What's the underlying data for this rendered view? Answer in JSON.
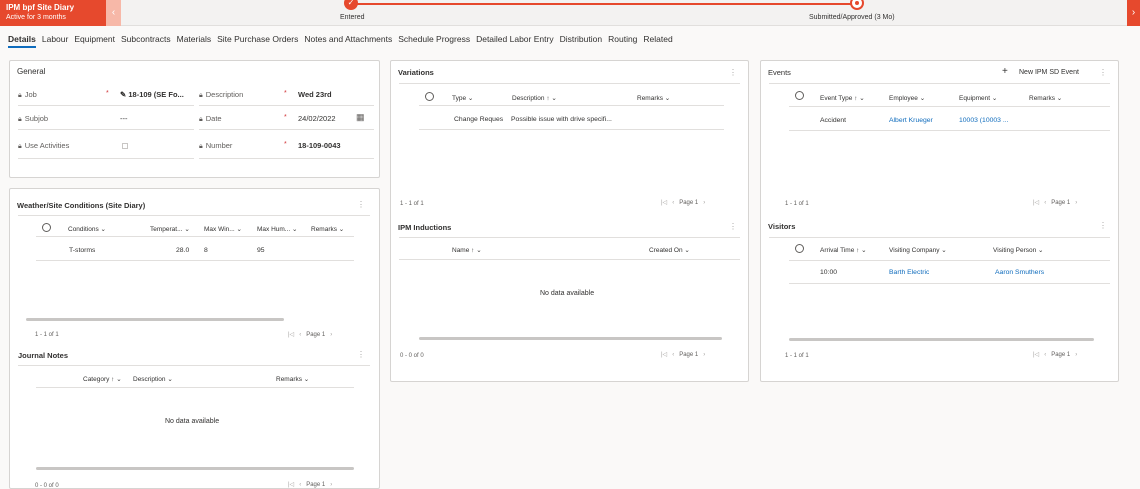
{
  "bpf": {
    "title": "IPM bpf Site Diary",
    "subtitle": "Active for 3 months",
    "prev_icon": "chevron-left-icon",
    "next_icon": "chevron-right-icon",
    "stages": [
      {
        "label": "Entered",
        "status": "completed",
        "check": "✓"
      },
      {
        "label": "Submitted/Approved  (3 Mo)",
        "status": "active"
      }
    ],
    "accent": "#e6492d"
  },
  "tabs": [
    {
      "label": "Details",
      "active": true
    },
    {
      "label": "Labour"
    },
    {
      "label": "Equipment"
    },
    {
      "label": "Subcontracts"
    },
    {
      "label": "Materials"
    },
    {
      "label": "Site Purchase Orders"
    },
    {
      "label": "Notes and Attachments"
    },
    {
      "label": "Schedule Progress"
    },
    {
      "label": "Detailed Labor Entry"
    },
    {
      "label": "Distribution"
    },
    {
      "label": "Routing"
    },
    {
      "label": "Related"
    }
  ],
  "general": {
    "title": "General",
    "fields": {
      "job": {
        "label": "Job",
        "value": "18-109 (SE Fo...",
        "required": "*"
      },
      "subjob": {
        "label": "Subjob",
        "value": "---"
      },
      "use_activities": {
        "label": "Use Activities"
      },
      "description": {
        "label": "Description",
        "value": "Wed 23rd",
        "required": "*"
      },
      "date": {
        "label": "Date",
        "value": "24/02/2022",
        "required": "*"
      },
      "number": {
        "label": "Number",
        "value": "18-109-0043",
        "required": "*"
      }
    }
  },
  "weather": {
    "title": "Weather/Site Conditions (Site Diary)",
    "columns": [
      "Conditions ⌄",
      "Temperat... ⌄",
      "Max Win... ⌄",
      "Max Hum... ⌄",
      "Remarks ⌄"
    ],
    "rows": [
      {
        "conditions": "T-storms",
        "temperature": "28.0",
        "max_wind": "8",
        "max_humidity": "95",
        "remarks": ""
      }
    ],
    "footer_count": "1 - 1 of 1",
    "page": "Page 1"
  },
  "journal": {
    "title": "Journal Notes",
    "columns": [
      "Category ↑ ⌄",
      "Description ⌄",
      "Remarks ⌄"
    ],
    "empty": "No data available",
    "footer_count": "0 - 0 of 0",
    "page": "Page 1"
  },
  "variations": {
    "title": "Variations",
    "columns": [
      "Type ⌄",
      "Description ↑ ⌄",
      "Remarks ⌄"
    ],
    "rows": [
      {
        "type": "Change Reques",
        "description": "Possible issue with drive specifi...",
        "remarks": ""
      }
    ],
    "footer_count": "1 - 1 of 1",
    "page": "Page 1"
  },
  "inductions": {
    "title": "IPM Inductions",
    "columns": [
      "Name ↑ ⌄",
      "Created On ⌄"
    ],
    "empty": "No data available",
    "footer_count": "0 - 0 of 0",
    "page": "Page 1"
  },
  "events": {
    "title": "Events",
    "new_label": "New IPM SD Event",
    "columns": [
      "Event Type ↑ ⌄",
      "Employee ⌄",
      "Equipment ⌄",
      "Remarks ⌄"
    ],
    "rows": [
      {
        "event_type": "Accident",
        "employee": "Albert Krueger",
        "equipment": "10003 (10003 ...",
        "remarks": ""
      }
    ],
    "footer_count": "1 - 1 of 1",
    "page": "Page 1"
  },
  "visitors": {
    "title": "Visitors",
    "columns": [
      "Arrival Time ↑ ⌄",
      "Visiting Company ⌄",
      "Visiting Person ⌄"
    ],
    "rows": [
      {
        "arrival_time": "10:00",
        "company": "Barth Electric",
        "person": "Aaron Smuthers"
      }
    ],
    "footer_count": "1 - 1 of 1",
    "page": "Page 1"
  },
  "pager": {
    "first": "|◁",
    "prev": "‹",
    "next": "›"
  },
  "icons": {
    "more": "more-icon",
    "lock": "lock-icon",
    "calendar": "calendar-icon",
    "add": "add-icon",
    "lookup": "lookup-icon"
  }
}
